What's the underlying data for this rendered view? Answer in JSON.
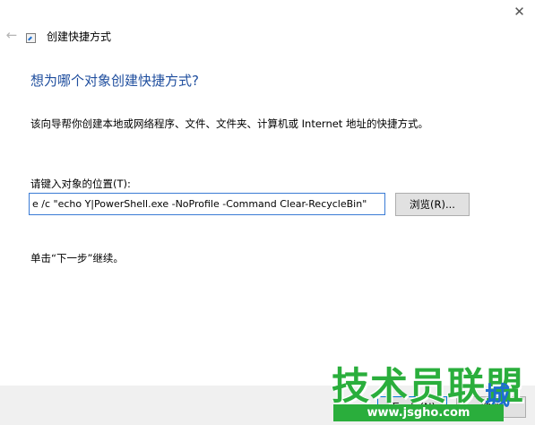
{
  "titlebar": {
    "close_glyph": "✕",
    "back_glyph": "←",
    "wizard_title": "创建快捷方式"
  },
  "main": {
    "heading": "想为哪个对象创建快捷方式?",
    "description": "该向导帮你创建本地或网络程序、文件、文件夹、计算机或 Internet 地址的快捷方式。",
    "location_label": "请键入对象的位置(T):",
    "location_value": "e /c \"echo Y|PowerShell.exe -NoProfile -Command Clear-RecycleBin\"",
    "browse_label": "浏览(R)...",
    "hint": "单击“下一步”继续。"
  },
  "footer": {
    "next_label": "下一步(N)",
    "cancel_label": "取消"
  },
  "watermark": {
    "brand": "技术员联盟",
    "suffix": "城",
    "url": "www.jsgho.com"
  },
  "colors": {
    "heading": "#1f4e9e",
    "input_border": "#3a7bd5",
    "watermark_green": "#2aae3c",
    "watermark_blue": "#1e6fcf"
  },
  "icons": {
    "back": "arrow-left-icon",
    "close": "close-icon",
    "wizard": "shortcut-icon"
  }
}
